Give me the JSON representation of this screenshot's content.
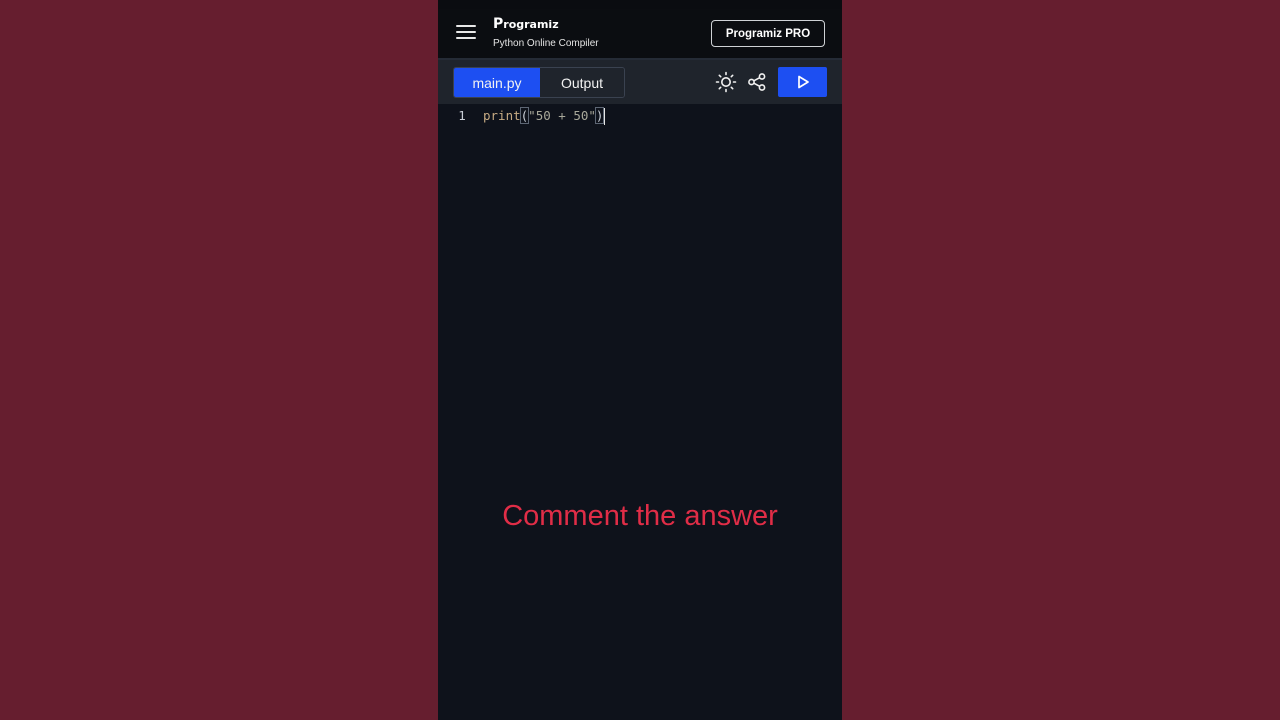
{
  "header": {
    "logo_text": "rogramiz",
    "logo_mark": "P",
    "subtitle": "Python Online Compiler",
    "pro_button_label": "Programiz PRO"
  },
  "toolbar": {
    "tabs": [
      {
        "label": "main.py",
        "active": true
      },
      {
        "label": "Output",
        "active": false
      }
    ],
    "icons": [
      "sun-icon",
      "share-icon",
      "play-icon"
    ]
  },
  "editor": {
    "lines": [
      {
        "number": "1",
        "fn": "print",
        "open_paren": "(",
        "string": "\"50 + 50\"",
        "close_paren": ")"
      }
    ]
  },
  "overlay": {
    "caption": "Comment the answer"
  },
  "colors": {
    "background": "#661e2f",
    "accent": "#1d4ff2",
    "caption": "#e02d47",
    "editor_bg": "#0e121b"
  }
}
